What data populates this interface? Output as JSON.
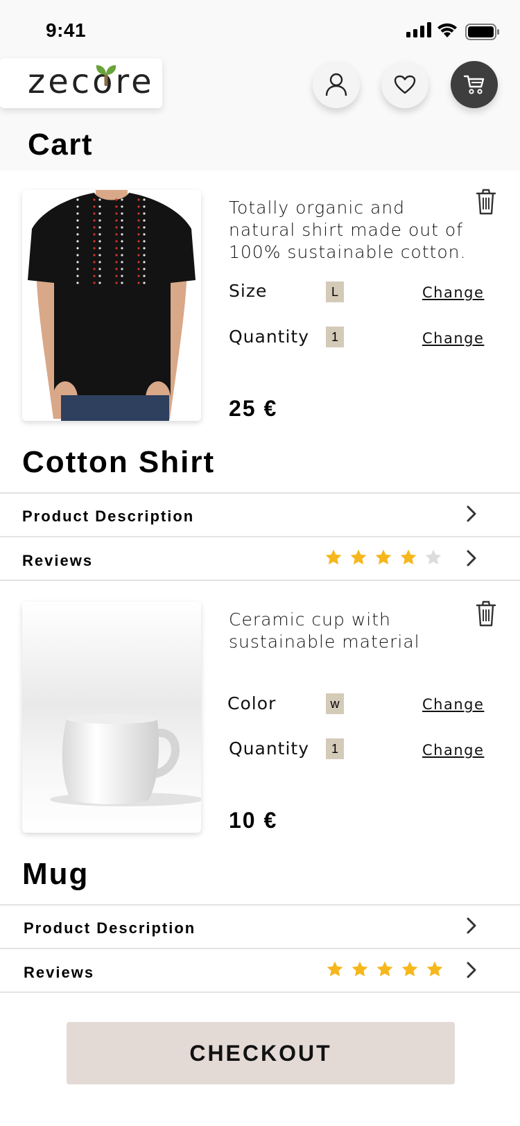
{
  "status_bar": {
    "time": "9:41"
  },
  "brand": {
    "logo_text": "zecore",
    "leaf_color": "#6aa33a",
    "stem_color": "#8a6a46"
  },
  "header": {
    "title": "Cart"
  },
  "colors": {
    "star_filled": "#f5b71b",
    "star_empty": "#dcdcdc",
    "option_chip": "#d4cab8",
    "checkout_bg": "#e3d9d5"
  },
  "items": [
    {
      "name": "Cotton Shirt",
      "description": "Totally organic and natural shirt made out of 100% sustainable cotton.",
      "options": [
        {
          "label": "Size",
          "value": "L",
          "action": "Change"
        },
        {
          "label": "Quantity",
          "value": "1",
          "action": "Change"
        }
      ],
      "price": "25 €",
      "rows": {
        "description_label": "Product Description",
        "reviews_label": "Reviews"
      },
      "rating": 4,
      "rating_max": 5,
      "image": "black t-shirt with embroidery"
    },
    {
      "name": "Mug",
      "description": "Ceramic cup with sustainable material",
      "options": [
        {
          "label": "Color",
          "value": "w",
          "action": "Change"
        },
        {
          "label": "Quantity",
          "value": "1",
          "action": "Change"
        }
      ],
      "price": "10 €",
      "rows": {
        "description_label": "Product Description",
        "reviews_label": "Reviews"
      },
      "rating": 5,
      "rating_max": 5,
      "image": "white ceramic mug"
    }
  ],
  "checkout": {
    "label": "CHECKOUT"
  }
}
